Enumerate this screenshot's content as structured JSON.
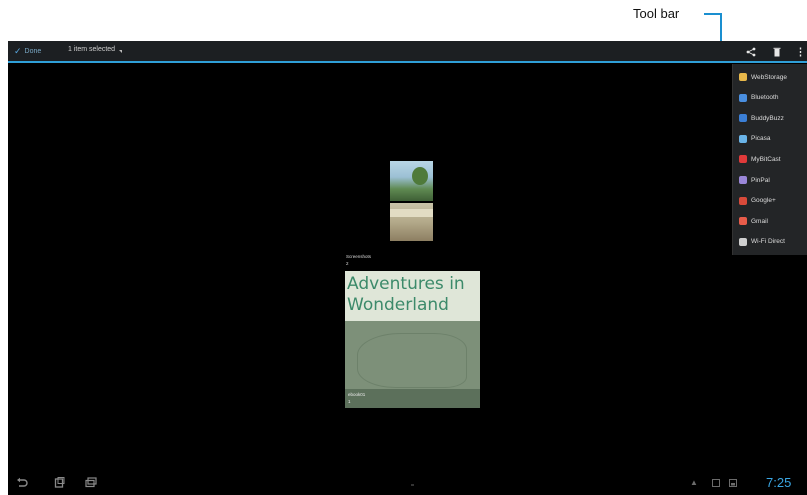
{
  "callout": {
    "label": "Tool bar"
  },
  "action_bar": {
    "done_label": "Done",
    "selection_label": "1 item selected"
  },
  "toolbar": {
    "icons": [
      "share-icon",
      "delete-icon",
      "overflow-menu-icon"
    ]
  },
  "share_menu": {
    "items": [
      {
        "label": "WebStorage",
        "icon": "webstorage-icon",
        "color": "#e8b84a"
      },
      {
        "label": "Bluetooth",
        "icon": "bluetooth-icon",
        "color": "#4a8fe0"
      },
      {
        "label": "BuddyBuzz",
        "icon": "buddybuzz-icon",
        "color": "#3b7fd6"
      },
      {
        "label": "Picasa",
        "icon": "picasa-icon",
        "color": "#6ab4e8"
      },
      {
        "label": "MyBitCast",
        "icon": "mybitcast-icon",
        "color": "#e03a3a"
      },
      {
        "label": "PinPal",
        "icon": "pinpal-icon",
        "color": "#9a86d8"
      },
      {
        "label": "Google+",
        "icon": "google-plus-icon",
        "color": "#d84a3a"
      },
      {
        "label": "Gmail",
        "icon": "gmail-icon",
        "color": "#e85c4a"
      },
      {
        "label": "Wi-Fi Direct",
        "icon": "wifi-direct-icon",
        "color": "#cfcfcf"
      }
    ]
  },
  "content": {
    "screenshots_label": "Screenshots",
    "screenshots_count": "2",
    "cover_title": "Adventures in Wonderland",
    "album_name": "ebook01",
    "album_count": "1"
  },
  "status": {
    "time": "7:25"
  }
}
